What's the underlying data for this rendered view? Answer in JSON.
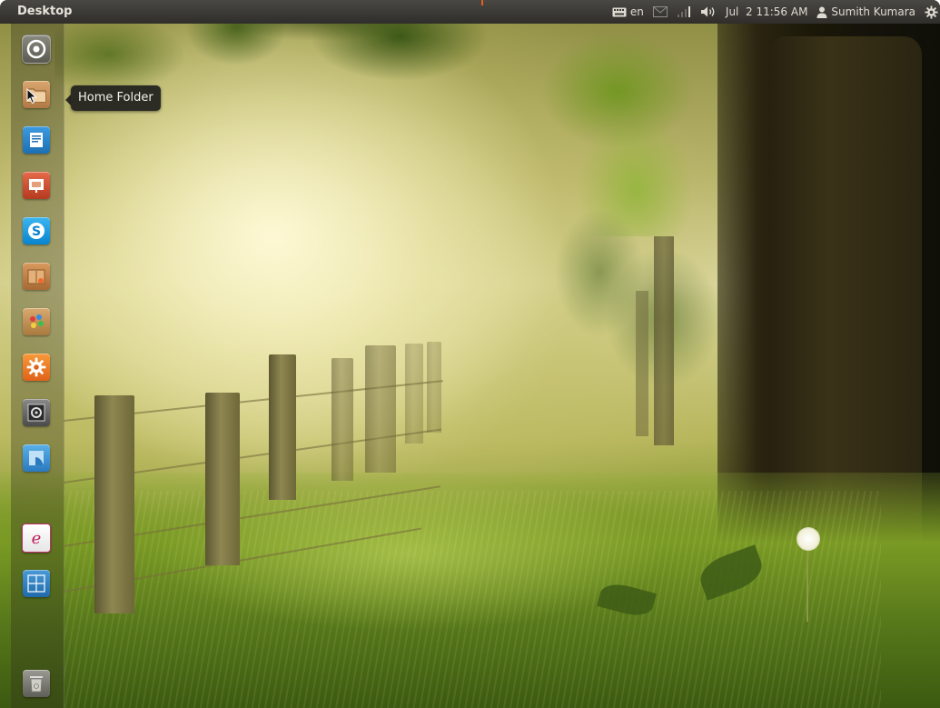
{
  "panel": {
    "title": "Desktop",
    "keyboard_layout": "en",
    "datetime": "Jul  2 11:56 AM",
    "user_name": "Sumith Kumara"
  },
  "indicators": {
    "keyboard_icon": "keyboard-icon",
    "mail_icon": "mail-icon",
    "network_icon": "signal-bars-icon",
    "sound_icon": "speaker-icon",
    "user_icon": "person-icon",
    "session_icon": "gear-icon"
  },
  "launcher": {
    "items": [
      {
        "name": "Dash Home",
        "icon": "ubuntu-logo-icon"
      },
      {
        "name": "Home Folder",
        "icon": "folder-icon"
      },
      {
        "name": "Writer",
        "icon": "document-icon"
      },
      {
        "name": "Impress",
        "icon": "presentation-icon"
      },
      {
        "name": "Skype",
        "icon": "skype-icon"
      },
      {
        "name": "Archive Manager",
        "icon": "package-icon"
      },
      {
        "name": "Paint",
        "icon": "palette-icon"
      },
      {
        "name": "Settings",
        "icon": "gear-icon"
      },
      {
        "name": "Terminal",
        "icon": "terminal-icon"
      },
      {
        "name": "Workspace",
        "icon": "workspace-icon"
      },
      {
        "name": "Evolution",
        "icon": "e-letter-icon"
      },
      {
        "name": "Workspace Switcher",
        "icon": "grid-icon"
      },
      {
        "name": "Trash",
        "icon": "trash-icon"
      }
    ]
  },
  "tooltip": {
    "text": "Home Folder"
  },
  "colors": {
    "panel": "#3c3b37",
    "panel_text": "#dfdbd2",
    "accent": "#e85d1a"
  }
}
